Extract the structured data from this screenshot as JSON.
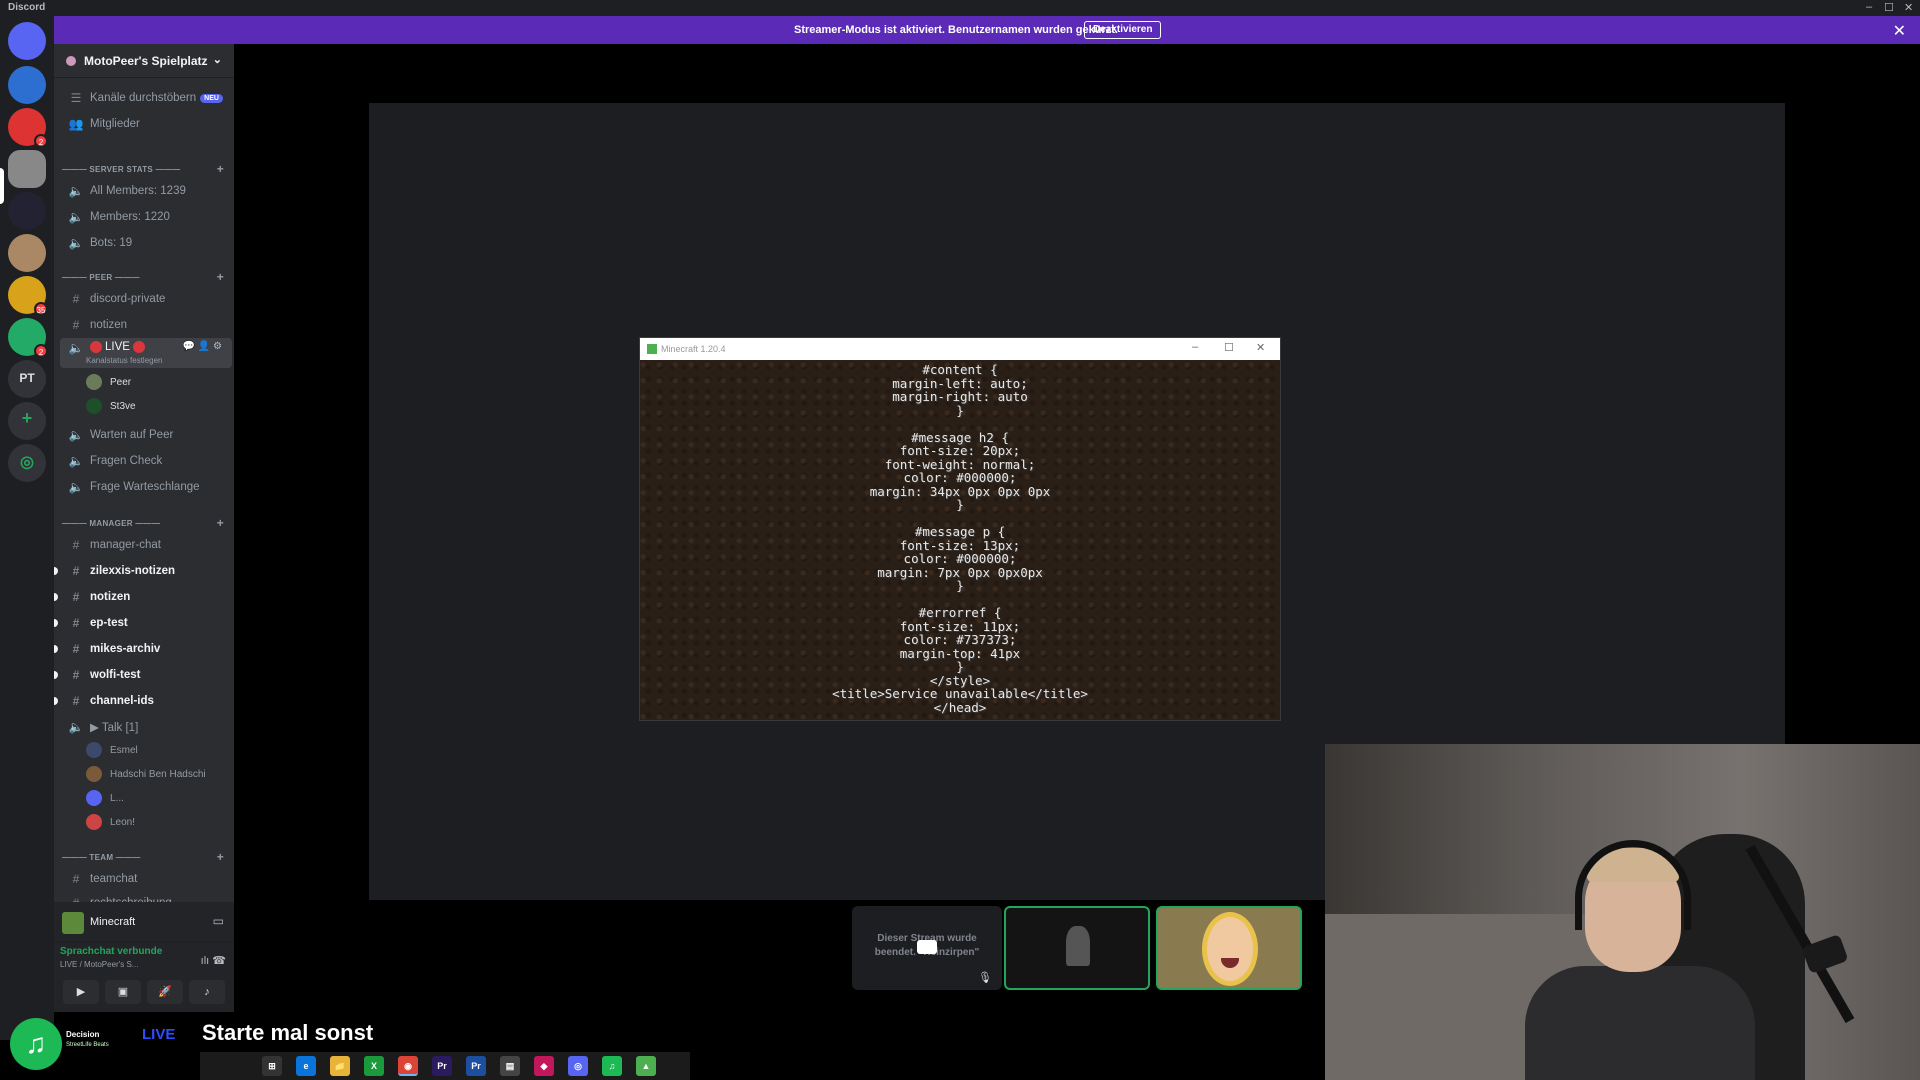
{
  "titlebar": {
    "app_name": "Discord",
    "minimize": "–",
    "maximize": "☐",
    "close": "✕"
  },
  "banner": {
    "text": "Streamer-Modus ist aktiviert. Benutzernamen wurden gekürzt.",
    "button": "Deaktivieren",
    "close": "✕"
  },
  "servers": {
    "pt_label": "PT",
    "badges": [
      "2",
      "35",
      "2"
    ]
  },
  "guild": {
    "name": "MotoPeer's Spielplatz",
    "chevron": "⌄"
  },
  "channels": {
    "browse": "Kanäle durchstöbern",
    "browse_tag": "NEU",
    "members": "Mitglieder",
    "cat_stats": "——— SERVER STATS ———",
    "all_members": "All Members: 1239",
    "members_count": "Members: 1220",
    "bots": "Bots: 19",
    "cat_peer": "——— PEER ———",
    "discord_private": "discord-private",
    "notizen": "notizen",
    "live": "LIVE",
    "live_status": "Kanalstatus festlegen",
    "live_users": [
      "Peer",
      "St3ve"
    ],
    "warten": "Warten auf Peer",
    "fragen": "Fragen Check",
    "warteschlange": "Frage Warteschlange",
    "cat_manager": "——— MANAGER ———",
    "manager_chat": "manager-chat",
    "zilexxis": "zilexxis-notizen",
    "notizen2": "notizen",
    "ep_test": "ep-test",
    "mikes": "mikes-archiv",
    "wolfi": "wolfi-test",
    "channel_ids": "channel-ids",
    "talk": "▶ Talk [1]",
    "talk_users": [
      "Esmel",
      "Hadschi Ben Hadschi",
      "L...",
      "Leon!"
    ],
    "cat_team": "——— TEAM ———",
    "teamchat": "teamchat",
    "partial": "rechtschreibung",
    "plus": "+"
  },
  "panel": {
    "app": "Minecraft",
    "voice_status": "Sprachchat verbunde",
    "voice_channel": "LIVE / MotoPeer's S...",
    "buttons": [
      "▶",
      "▣",
      "🚀",
      "♪"
    ]
  },
  "minecraft": {
    "title": "Minecraft 1.20.4",
    "code_lines": [
      "#content {",
      "margin-left: auto;",
      "margin-right: auto",
      "}",
      "",
      "#message h2 {",
      "font-size: 20px;",
      "font-weight: normal;",
      "color: #000000;",
      "margin: 34px 0px 0px 0px",
      "}",
      "",
      "#message p {",
      "font-size: 13px;",
      "color: #000000;",
      "margin: 7px 0px 0px0px",
      "}",
      "",
      "#errorref {",
      "font-size: 11px;",
      "color: #737373;",
      "margin-top: 41px",
      "}",
      "</style>",
      "<title>Service unavailable</title>",
      "</head>"
    ]
  },
  "stream_tile": {
    "ended_text": "Dieser Stream wurde beendet. \"Reinzirpen\"",
    "mic": "🎙"
  },
  "overlay": {
    "now_playing": "Decision",
    "now_playing_sub": "StreetLife Beats",
    "live_tag": "LIVE",
    "caption": "Starte mal sonst"
  },
  "taskbar": {
    "items": [
      "⊞",
      "e",
      "📁",
      "X",
      "◉",
      "Pr",
      "Pr",
      "▤",
      "◆",
      "◎",
      "♫",
      "▲"
    ]
  }
}
